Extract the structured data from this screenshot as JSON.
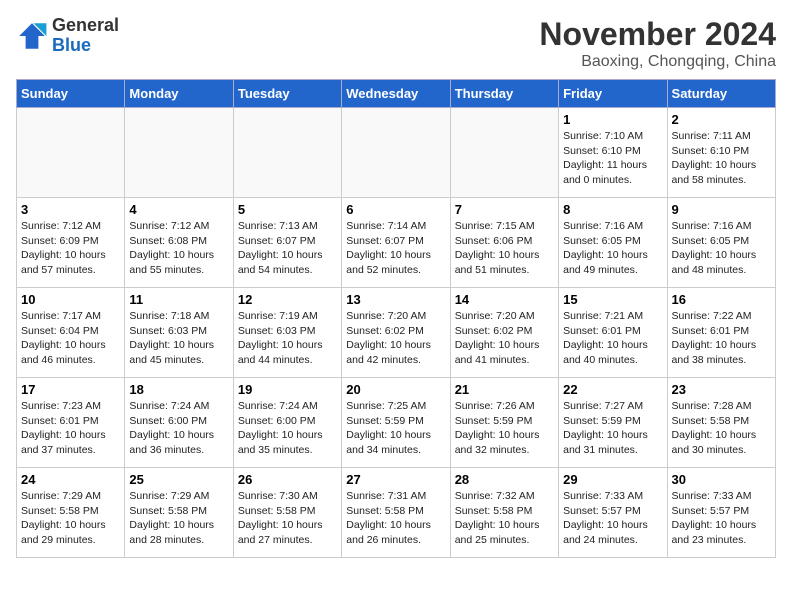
{
  "logo": {
    "general": "General",
    "blue": "Blue"
  },
  "header": {
    "month": "November 2024",
    "location": "Baoxing, Chongqing, China"
  },
  "weekdays": [
    "Sunday",
    "Monday",
    "Tuesday",
    "Wednesday",
    "Thursday",
    "Friday",
    "Saturday"
  ],
  "weeks": [
    [
      {
        "day": "",
        "info": ""
      },
      {
        "day": "",
        "info": ""
      },
      {
        "day": "",
        "info": ""
      },
      {
        "day": "",
        "info": ""
      },
      {
        "day": "",
        "info": ""
      },
      {
        "day": "1",
        "info": "Sunrise: 7:10 AM\nSunset: 6:10 PM\nDaylight: 11 hours\nand 0 minutes."
      },
      {
        "day": "2",
        "info": "Sunrise: 7:11 AM\nSunset: 6:10 PM\nDaylight: 10 hours\nand 58 minutes."
      }
    ],
    [
      {
        "day": "3",
        "info": "Sunrise: 7:12 AM\nSunset: 6:09 PM\nDaylight: 10 hours\nand 57 minutes."
      },
      {
        "day": "4",
        "info": "Sunrise: 7:12 AM\nSunset: 6:08 PM\nDaylight: 10 hours\nand 55 minutes."
      },
      {
        "day": "5",
        "info": "Sunrise: 7:13 AM\nSunset: 6:07 PM\nDaylight: 10 hours\nand 54 minutes."
      },
      {
        "day": "6",
        "info": "Sunrise: 7:14 AM\nSunset: 6:07 PM\nDaylight: 10 hours\nand 52 minutes."
      },
      {
        "day": "7",
        "info": "Sunrise: 7:15 AM\nSunset: 6:06 PM\nDaylight: 10 hours\nand 51 minutes."
      },
      {
        "day": "8",
        "info": "Sunrise: 7:16 AM\nSunset: 6:05 PM\nDaylight: 10 hours\nand 49 minutes."
      },
      {
        "day": "9",
        "info": "Sunrise: 7:16 AM\nSunset: 6:05 PM\nDaylight: 10 hours\nand 48 minutes."
      }
    ],
    [
      {
        "day": "10",
        "info": "Sunrise: 7:17 AM\nSunset: 6:04 PM\nDaylight: 10 hours\nand 46 minutes."
      },
      {
        "day": "11",
        "info": "Sunrise: 7:18 AM\nSunset: 6:03 PM\nDaylight: 10 hours\nand 45 minutes."
      },
      {
        "day": "12",
        "info": "Sunrise: 7:19 AM\nSunset: 6:03 PM\nDaylight: 10 hours\nand 44 minutes."
      },
      {
        "day": "13",
        "info": "Sunrise: 7:20 AM\nSunset: 6:02 PM\nDaylight: 10 hours\nand 42 minutes."
      },
      {
        "day": "14",
        "info": "Sunrise: 7:20 AM\nSunset: 6:02 PM\nDaylight: 10 hours\nand 41 minutes."
      },
      {
        "day": "15",
        "info": "Sunrise: 7:21 AM\nSunset: 6:01 PM\nDaylight: 10 hours\nand 40 minutes."
      },
      {
        "day": "16",
        "info": "Sunrise: 7:22 AM\nSunset: 6:01 PM\nDaylight: 10 hours\nand 38 minutes."
      }
    ],
    [
      {
        "day": "17",
        "info": "Sunrise: 7:23 AM\nSunset: 6:01 PM\nDaylight: 10 hours\nand 37 minutes."
      },
      {
        "day": "18",
        "info": "Sunrise: 7:24 AM\nSunset: 6:00 PM\nDaylight: 10 hours\nand 36 minutes."
      },
      {
        "day": "19",
        "info": "Sunrise: 7:24 AM\nSunset: 6:00 PM\nDaylight: 10 hours\nand 35 minutes."
      },
      {
        "day": "20",
        "info": "Sunrise: 7:25 AM\nSunset: 5:59 PM\nDaylight: 10 hours\nand 34 minutes."
      },
      {
        "day": "21",
        "info": "Sunrise: 7:26 AM\nSunset: 5:59 PM\nDaylight: 10 hours\nand 32 minutes."
      },
      {
        "day": "22",
        "info": "Sunrise: 7:27 AM\nSunset: 5:59 PM\nDaylight: 10 hours\nand 31 minutes."
      },
      {
        "day": "23",
        "info": "Sunrise: 7:28 AM\nSunset: 5:58 PM\nDaylight: 10 hours\nand 30 minutes."
      }
    ],
    [
      {
        "day": "24",
        "info": "Sunrise: 7:29 AM\nSunset: 5:58 PM\nDaylight: 10 hours\nand 29 minutes."
      },
      {
        "day": "25",
        "info": "Sunrise: 7:29 AM\nSunset: 5:58 PM\nDaylight: 10 hours\nand 28 minutes."
      },
      {
        "day": "26",
        "info": "Sunrise: 7:30 AM\nSunset: 5:58 PM\nDaylight: 10 hours\nand 27 minutes."
      },
      {
        "day": "27",
        "info": "Sunrise: 7:31 AM\nSunset: 5:58 PM\nDaylight: 10 hours\nand 26 minutes."
      },
      {
        "day": "28",
        "info": "Sunrise: 7:32 AM\nSunset: 5:58 PM\nDaylight: 10 hours\nand 25 minutes."
      },
      {
        "day": "29",
        "info": "Sunrise: 7:33 AM\nSunset: 5:57 PM\nDaylight: 10 hours\nand 24 minutes."
      },
      {
        "day": "30",
        "info": "Sunrise: 7:33 AM\nSunset: 5:57 PM\nDaylight: 10 hours\nand 23 minutes."
      }
    ]
  ]
}
